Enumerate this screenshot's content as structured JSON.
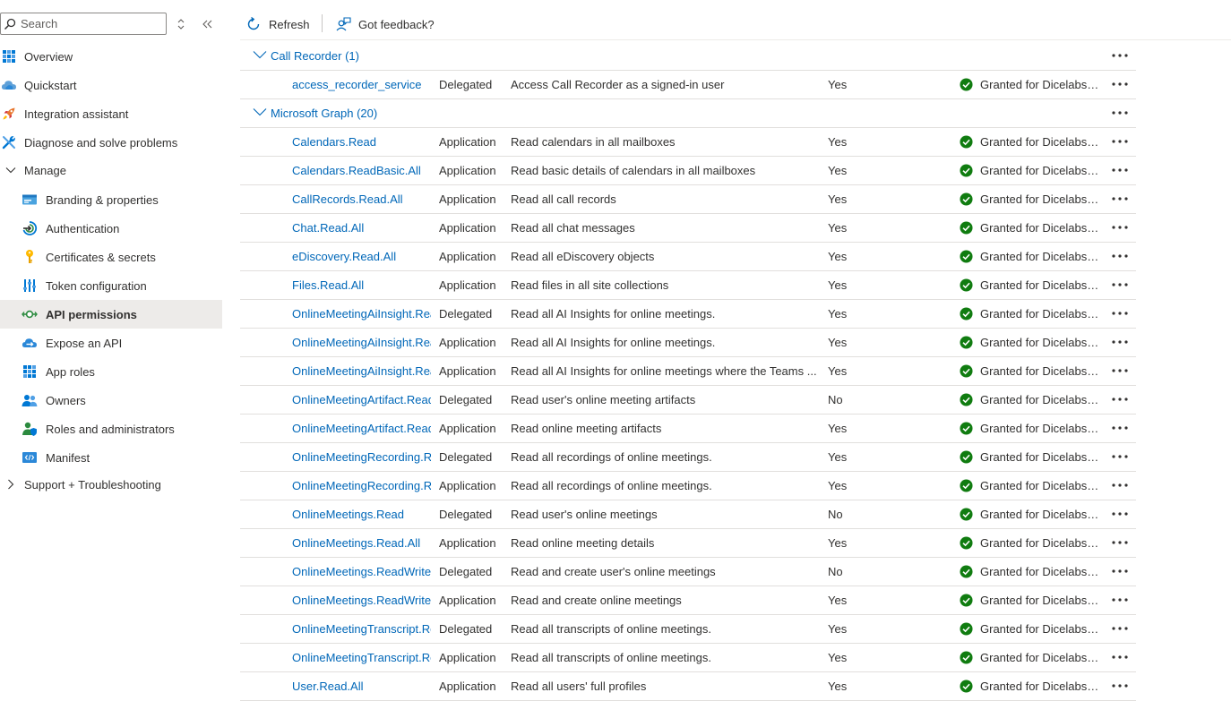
{
  "sidebar": {
    "search_placeholder": "Search",
    "items": [
      {
        "label": "Overview",
        "name": "sidebar-item-overview",
        "icon": "overview-grid-icon",
        "indent": 0
      },
      {
        "label": "Quickstart",
        "name": "sidebar-item-quickstart",
        "icon": "cloud-icon",
        "indent": 0
      },
      {
        "label": "Integration assistant",
        "name": "sidebar-item-integration-assistant",
        "icon": "rocket-icon",
        "indent": 0
      },
      {
        "label": "Diagnose and solve problems",
        "name": "sidebar-item-diagnose",
        "icon": "wrench-icon",
        "indent": 0
      },
      {
        "label": "Manage",
        "name": "sidebar-group-manage",
        "icon": "chevron-down-icon",
        "indent": 0
      },
      {
        "label": "Branding & properties",
        "name": "sidebar-item-branding",
        "icon": "branding-card-icon",
        "indent": 1
      },
      {
        "label": "Authentication",
        "name": "sidebar-item-authentication",
        "icon": "authentication-icon",
        "indent": 1
      },
      {
        "label": "Certificates & secrets",
        "name": "sidebar-item-certificates",
        "icon": "key-icon",
        "indent": 1
      },
      {
        "label": "Token configuration",
        "name": "sidebar-item-token-configuration",
        "icon": "token-bars-icon",
        "indent": 1
      },
      {
        "label": "API permissions",
        "name": "sidebar-item-api-permissions",
        "icon": "api-permissions-icon",
        "indent": 1,
        "active": true
      },
      {
        "label": "Expose an API",
        "name": "sidebar-item-expose-api",
        "icon": "cloud-expose-icon",
        "indent": 1
      },
      {
        "label": "App roles",
        "name": "sidebar-item-app-roles",
        "icon": "app-roles-grid-icon",
        "indent": 1
      },
      {
        "label": "Owners",
        "name": "sidebar-item-owners",
        "icon": "owners-people-icon",
        "indent": 1
      },
      {
        "label": "Roles and administrators",
        "name": "sidebar-item-roles-administrators",
        "icon": "roles-admin-icon",
        "indent": 1
      },
      {
        "label": "Manifest",
        "name": "sidebar-item-manifest",
        "icon": "manifest-code-icon",
        "indent": 1
      },
      {
        "label": "Support + Troubleshooting",
        "name": "sidebar-group-support",
        "icon": "chevron-right-icon",
        "indent": 0
      }
    ]
  },
  "toolbar": {
    "refresh_label": "Refresh",
    "feedback_label": "Got feedback?"
  },
  "colors": {
    "link": "#0067b8",
    "success": "#107c10",
    "active_bg": "#edebe9"
  },
  "groups": [
    {
      "label": "Call Recorder (1)",
      "permissions": [
        {
          "name": "access_recorder_service",
          "type": "Delegated",
          "description": "Access Call Recorder as a signed-in user",
          "admin_consent": "Yes",
          "status": "Granted for Dicelabs Te..."
        }
      ]
    },
    {
      "label": "Microsoft Graph (20)",
      "permissions": [
        {
          "name": "Calendars.Read",
          "type": "Application",
          "description": "Read calendars in all mailboxes",
          "admin_consent": "Yes",
          "status": "Granted for Dicelabs Te..."
        },
        {
          "name": "Calendars.ReadBasic.All",
          "type": "Application",
          "description": "Read basic details of calendars in all mailboxes",
          "admin_consent": "Yes",
          "status": "Granted for Dicelabs Te..."
        },
        {
          "name": "CallRecords.Read.All",
          "type": "Application",
          "description": "Read all call records",
          "admin_consent": "Yes",
          "status": "Granted for Dicelabs Te..."
        },
        {
          "name": "Chat.Read.All",
          "type": "Application",
          "description": "Read all chat messages",
          "admin_consent": "Yes",
          "status": "Granted for Dicelabs Te..."
        },
        {
          "name": "eDiscovery.Read.All",
          "type": "Application",
          "description": "Read all eDiscovery objects",
          "admin_consent": "Yes",
          "status": "Granted for Dicelabs Te..."
        },
        {
          "name": "Files.Read.All",
          "type": "Application",
          "description": "Read files in all site collections",
          "admin_consent": "Yes",
          "status": "Granted for Dicelabs Te..."
        },
        {
          "name": "OnlineMeetingAiInsight.Read",
          "type": "Delegated",
          "description": "Read all AI Insights for online meetings.",
          "admin_consent": "Yes",
          "status": "Granted for Dicelabs Te..."
        },
        {
          "name": "OnlineMeetingAiInsight.Read",
          "type": "Application",
          "description": "Read all AI Insights for online meetings.",
          "admin_consent": "Yes",
          "status": "Granted for Dicelabs Te..."
        },
        {
          "name": "OnlineMeetingAiInsight.Read",
          "type": "Application",
          "description": "Read all AI Insights for online meetings where the Teams ...",
          "admin_consent": "Yes",
          "status": "Granted for Dicelabs Te..."
        },
        {
          "name": "OnlineMeetingArtifact.Read.A",
          "type": "Delegated",
          "description": "Read user's online meeting artifacts",
          "admin_consent": "No",
          "status": "Granted for Dicelabs Te..."
        },
        {
          "name": "OnlineMeetingArtifact.Read.A",
          "type": "Application",
          "description": "Read online meeting artifacts",
          "admin_consent": "Yes",
          "status": "Granted for Dicelabs Te..."
        },
        {
          "name": "OnlineMeetingRecording.Rea",
          "type": "Delegated",
          "description": "Read all recordings of online meetings.",
          "admin_consent": "Yes",
          "status": "Granted for Dicelabs Te..."
        },
        {
          "name": "OnlineMeetingRecording.Rea",
          "type": "Application",
          "description": "Read all recordings of online meetings.",
          "admin_consent": "Yes",
          "status": "Granted for Dicelabs Te..."
        },
        {
          "name": "OnlineMeetings.Read",
          "type": "Delegated",
          "description": "Read user's online meetings",
          "admin_consent": "No",
          "status": "Granted for Dicelabs Te..."
        },
        {
          "name": "OnlineMeetings.Read.All",
          "type": "Application",
          "description": "Read online meeting details",
          "admin_consent": "Yes",
          "status": "Granted for Dicelabs Te..."
        },
        {
          "name": "OnlineMeetings.ReadWrite",
          "type": "Delegated",
          "description": "Read and create user's online meetings",
          "admin_consent": "No",
          "status": "Granted for Dicelabs Te..."
        },
        {
          "name": "OnlineMeetings.ReadWrite.Al",
          "type": "Application",
          "description": "Read and create online meetings",
          "admin_consent": "Yes",
          "status": "Granted for Dicelabs Te..."
        },
        {
          "name": "OnlineMeetingTranscript.Rea",
          "type": "Delegated",
          "description": "Read all transcripts of online meetings.",
          "admin_consent": "Yes",
          "status": "Granted for Dicelabs Te..."
        },
        {
          "name": "OnlineMeetingTranscript.Rea",
          "type": "Application",
          "description": "Read all transcripts of online meetings.",
          "admin_consent": "Yes",
          "status": "Granted for Dicelabs Te..."
        },
        {
          "name": "User.Read.All",
          "type": "Application",
          "description": "Read all users' full profiles",
          "admin_consent": "Yes",
          "status": "Granted for Dicelabs Te..."
        }
      ]
    }
  ]
}
